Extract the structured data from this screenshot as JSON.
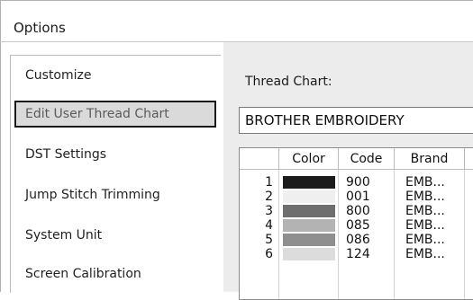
{
  "window": {
    "title": "Options"
  },
  "sidebar": {
    "items": [
      {
        "label": "Customize",
        "selected": false
      },
      {
        "label": "Edit User Thread Chart",
        "selected": true
      },
      {
        "label": "DST Settings",
        "selected": false
      },
      {
        "label": "Jump Stitch Trimming",
        "selected": false
      },
      {
        "label": "System Unit",
        "selected": false
      },
      {
        "label": "Screen Calibration",
        "selected": false
      }
    ]
  },
  "main": {
    "thread_chart_label": "Thread Chart:",
    "thread_chart_value": "BROTHER EMBROIDERY",
    "table": {
      "columns": [
        "",
        "Color",
        "Code",
        "Brand"
      ],
      "rows": [
        {
          "num": "1",
          "color": "#1c1c1c",
          "code": "900",
          "brand": "EMB..."
        },
        {
          "num": "2",
          "color": "#efefef",
          "code": "001",
          "brand": "EMB..."
        },
        {
          "num": "3",
          "color": "#6e6e6e",
          "code": "800",
          "brand": "EMB..."
        },
        {
          "num": "4",
          "color": "#b3b3b3",
          "code": "085",
          "brand": "EMB..."
        },
        {
          "num": "5",
          "color": "#8f8f8f",
          "code": "086",
          "brand": "EMB..."
        },
        {
          "num": "6",
          "color": "#dcdcdc",
          "code": "124",
          "brand": "EMB..."
        }
      ]
    }
  }
}
